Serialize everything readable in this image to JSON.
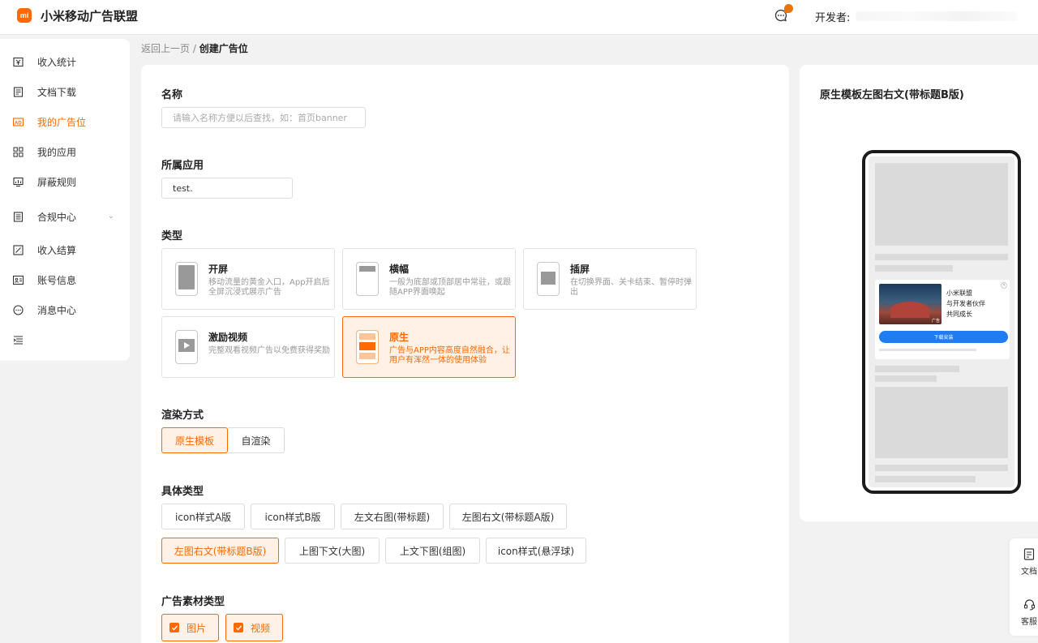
{
  "header": {
    "logo_text": "mi",
    "title": "小米移动广告联盟",
    "developer_label": "开发者:",
    "accent_color": "#ff6900"
  },
  "sidebar": {
    "items": [
      {
        "label": "收入统计",
        "icon": "income-stats-icon"
      },
      {
        "label": "文档下载",
        "icon": "doc-download-icon"
      },
      {
        "label": "我的广告位",
        "icon": "ad-slot-icon",
        "active": true
      },
      {
        "label": "我的应用",
        "icon": "apps-grid-icon"
      },
      {
        "label": "屏蔽规则",
        "icon": "block-rules-icon"
      },
      {
        "label": "合规中心",
        "icon": "compliance-icon",
        "expandable": true
      },
      {
        "label": "收入结算",
        "icon": "settlement-icon"
      },
      {
        "label": "账号信息",
        "icon": "account-info-icon"
      },
      {
        "label": "消息中心",
        "icon": "message-center-icon"
      }
    ]
  },
  "breadcrumb": {
    "back": "返回上一页",
    "separator": "/",
    "current": "创建广告位"
  },
  "form": {
    "name": {
      "label": "名称",
      "placeholder": "请输入名称方便以后查找，如：首页banner"
    },
    "app": {
      "label": "所属应用",
      "value": "test."
    },
    "type": {
      "label": "类型",
      "options": [
        {
          "name": "开屏",
          "desc": "移动流量的黄金入口，App开启后全屏沉浸式展示广告"
        },
        {
          "name": "横幅",
          "desc": "一般为底部或顶部居中常驻，或跟随APP界面唤起"
        },
        {
          "name": "插屏",
          "desc": "在切换界面、关卡结束、暂停时弹出"
        },
        {
          "name": "激励视频",
          "desc": "完整观看视频广告以免费获得奖励"
        },
        {
          "name": "原生",
          "desc": "广告与APP内容高度自然融合，让用户有浑然一体的使用体验",
          "selected": true
        }
      ]
    },
    "render": {
      "label": "渲染方式",
      "options": [
        {
          "label": "原生模板",
          "selected": true
        },
        {
          "label": "自渲染"
        }
      ]
    },
    "subtype": {
      "label": "具体类型",
      "options": [
        {
          "label": "icon样式A版"
        },
        {
          "label": "icon样式B版"
        },
        {
          "label": "左文右图(带标题)"
        },
        {
          "label": "左图右文(带标题A版)"
        },
        {
          "label": "左图右文(带标题B版)",
          "selected": true
        },
        {
          "label": "上图下文(大图)"
        },
        {
          "label": "上文下图(组图)"
        },
        {
          "label": "icon样式(悬浮球)"
        }
      ]
    },
    "material": {
      "label": "广告素材类型",
      "options": [
        {
          "label": "图片",
          "checked": true
        },
        {
          "label": "视频",
          "checked": true
        }
      ]
    }
  },
  "preview": {
    "title": "原生模板左图右文(带标题B版)",
    "ad_text_lines": [
      "小米联盟",
      "与开发者伙伴",
      "共同成长"
    ],
    "ad_badge": "广告",
    "cta_label": "下载安装",
    "cta_color": "#1f7cf2"
  },
  "float_bar": {
    "doc_label": "文档",
    "service_label": "客服"
  }
}
